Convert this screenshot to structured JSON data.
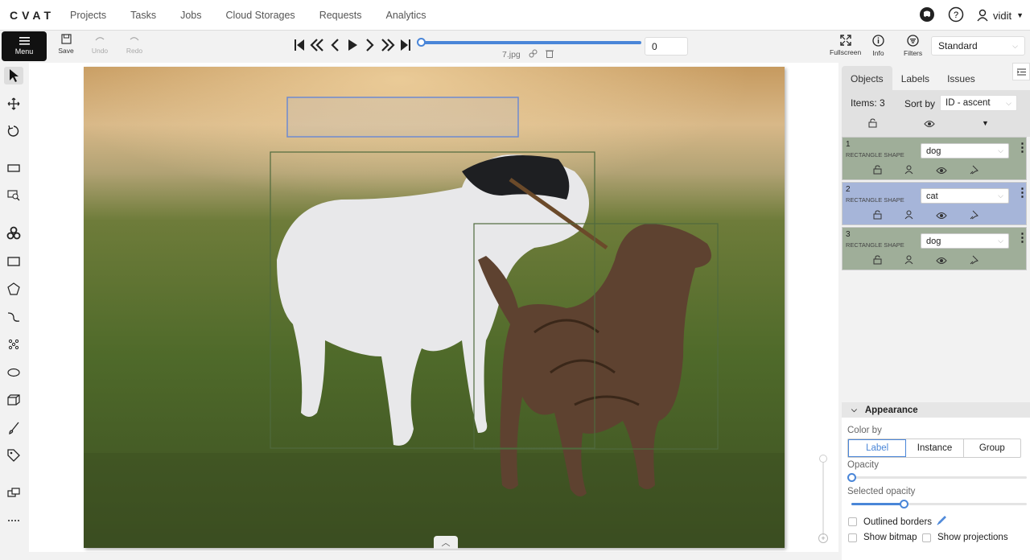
{
  "app": {
    "logo": "CVAT"
  },
  "nav": {
    "links": [
      "Projects",
      "Tasks",
      "Jobs",
      "Cloud Storages",
      "Requests",
      "Analytics"
    ],
    "user": "vidit"
  },
  "toolbar": {
    "menu": "Menu",
    "save": "Save",
    "undo": "Undo",
    "redo": "Redo",
    "frame": "0",
    "filename": "7.jpg",
    "fullscreen": "Fullscreen",
    "info": "Info",
    "filters": "Filters",
    "workspace": "Standard"
  },
  "sidebar": {
    "tabs": [
      "Objects",
      "Labels",
      "Issues"
    ],
    "items_count": "Items: 3",
    "sort_label": "Sort by",
    "sort_value": "ID - ascent",
    "objects": [
      {
        "id": "1",
        "type": "RECTANGLE SHAPE",
        "label": "dog",
        "color": "#9fae99"
      },
      {
        "id": "2",
        "type": "RECTANGLE SHAPE",
        "label": "cat",
        "color": "#a6b5d9"
      },
      {
        "id": "3",
        "type": "RECTANGLE SHAPE",
        "label": "dog",
        "color": "#9fae99"
      }
    ]
  },
  "appearance": {
    "title": "Appearance",
    "color_by_label": "Color by",
    "color_by_options": [
      "Label",
      "Instance",
      "Group"
    ],
    "color_by_selected": "Label",
    "opacity_label": "Opacity",
    "opacity_value": 0,
    "selected_opacity_label": "Selected opacity",
    "selected_opacity_value": 0.3,
    "outlined_borders": "Outlined borders",
    "show_bitmap": "Show bitmap",
    "show_projections": "Show projections"
  }
}
